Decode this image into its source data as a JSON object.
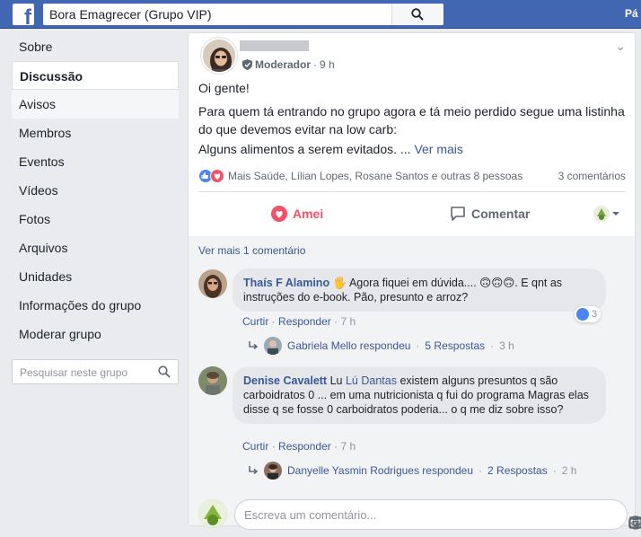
{
  "topbar": {
    "search_value": "Bora Emagrecer (Grupo VIP)",
    "right_text": "Pá",
    "brand_color": "#4267b2",
    "logo_letter": "f"
  },
  "sidebar": {
    "items": [
      {
        "label": "Sobre"
      },
      {
        "label": "Discussão"
      },
      {
        "label": "Avisos"
      },
      {
        "label": "Membros"
      },
      {
        "label": "Eventos"
      },
      {
        "label": "Vídeos"
      },
      {
        "label": "Fotos"
      },
      {
        "label": "Arquivos"
      },
      {
        "label": "Unidades"
      },
      {
        "label": "Informações do grupo"
      },
      {
        "label": "Moderar grupo"
      }
    ],
    "active_index": 1,
    "search_placeholder": "Pesquisar neste grupo"
  },
  "post": {
    "role": "Moderador",
    "time": "9 h",
    "text_1": "Oi gente!",
    "text_2": "Para quem tá entrando no grupo agora e tá meio perdido segue uma listinha do que devemos evitar na low carb:",
    "text_3": "Alguns alimentos a serem evitados. ...",
    "see_more": "Ver mais",
    "reactions_text": "Mais Saúde, Lílian Lopes, Rosane Santos e outras 8 pessoas",
    "comments_count": "3 comentários",
    "love_label": "Amei",
    "comment_label": "Comentar",
    "love_color": "#f25268"
  },
  "comments": {
    "see_more": "Ver mais 1 comentário",
    "list": [
      {
        "name": "Thaís F Alamino",
        "text": "Agora fiquei em dúvida.... 🙃🙃🙃. E qnt as instruções do e-book. Pão, presunto e arroz?",
        "like_label": "Curtir",
        "reply_label": "Responder",
        "time": "7 h",
        "reactions": "3",
        "reply_author": "Gabriela Mello respondeu",
        "reply_count": "5 Respostas",
        "reply_time": "3 h"
      },
      {
        "name": "Denise Cavalett",
        "mention": "Lú Dantas",
        "text_before": "Lu",
        "text_after": "existem alguns presuntos q são carboidratos 0 ... em uma nutricionista q fui do programa Magras elas disse q se fosse 0 carboidratos poderia... o q me diz sobre isso?",
        "like_label": "Curtir",
        "reply_label": "Responder",
        "time": "7 h",
        "reply_author": "Danyelle Yasmin Rodrigues respondeu",
        "reply_count": "2 Respostas",
        "reply_time": "2 h"
      }
    ],
    "input_placeholder": "Escreva um comentário..."
  }
}
